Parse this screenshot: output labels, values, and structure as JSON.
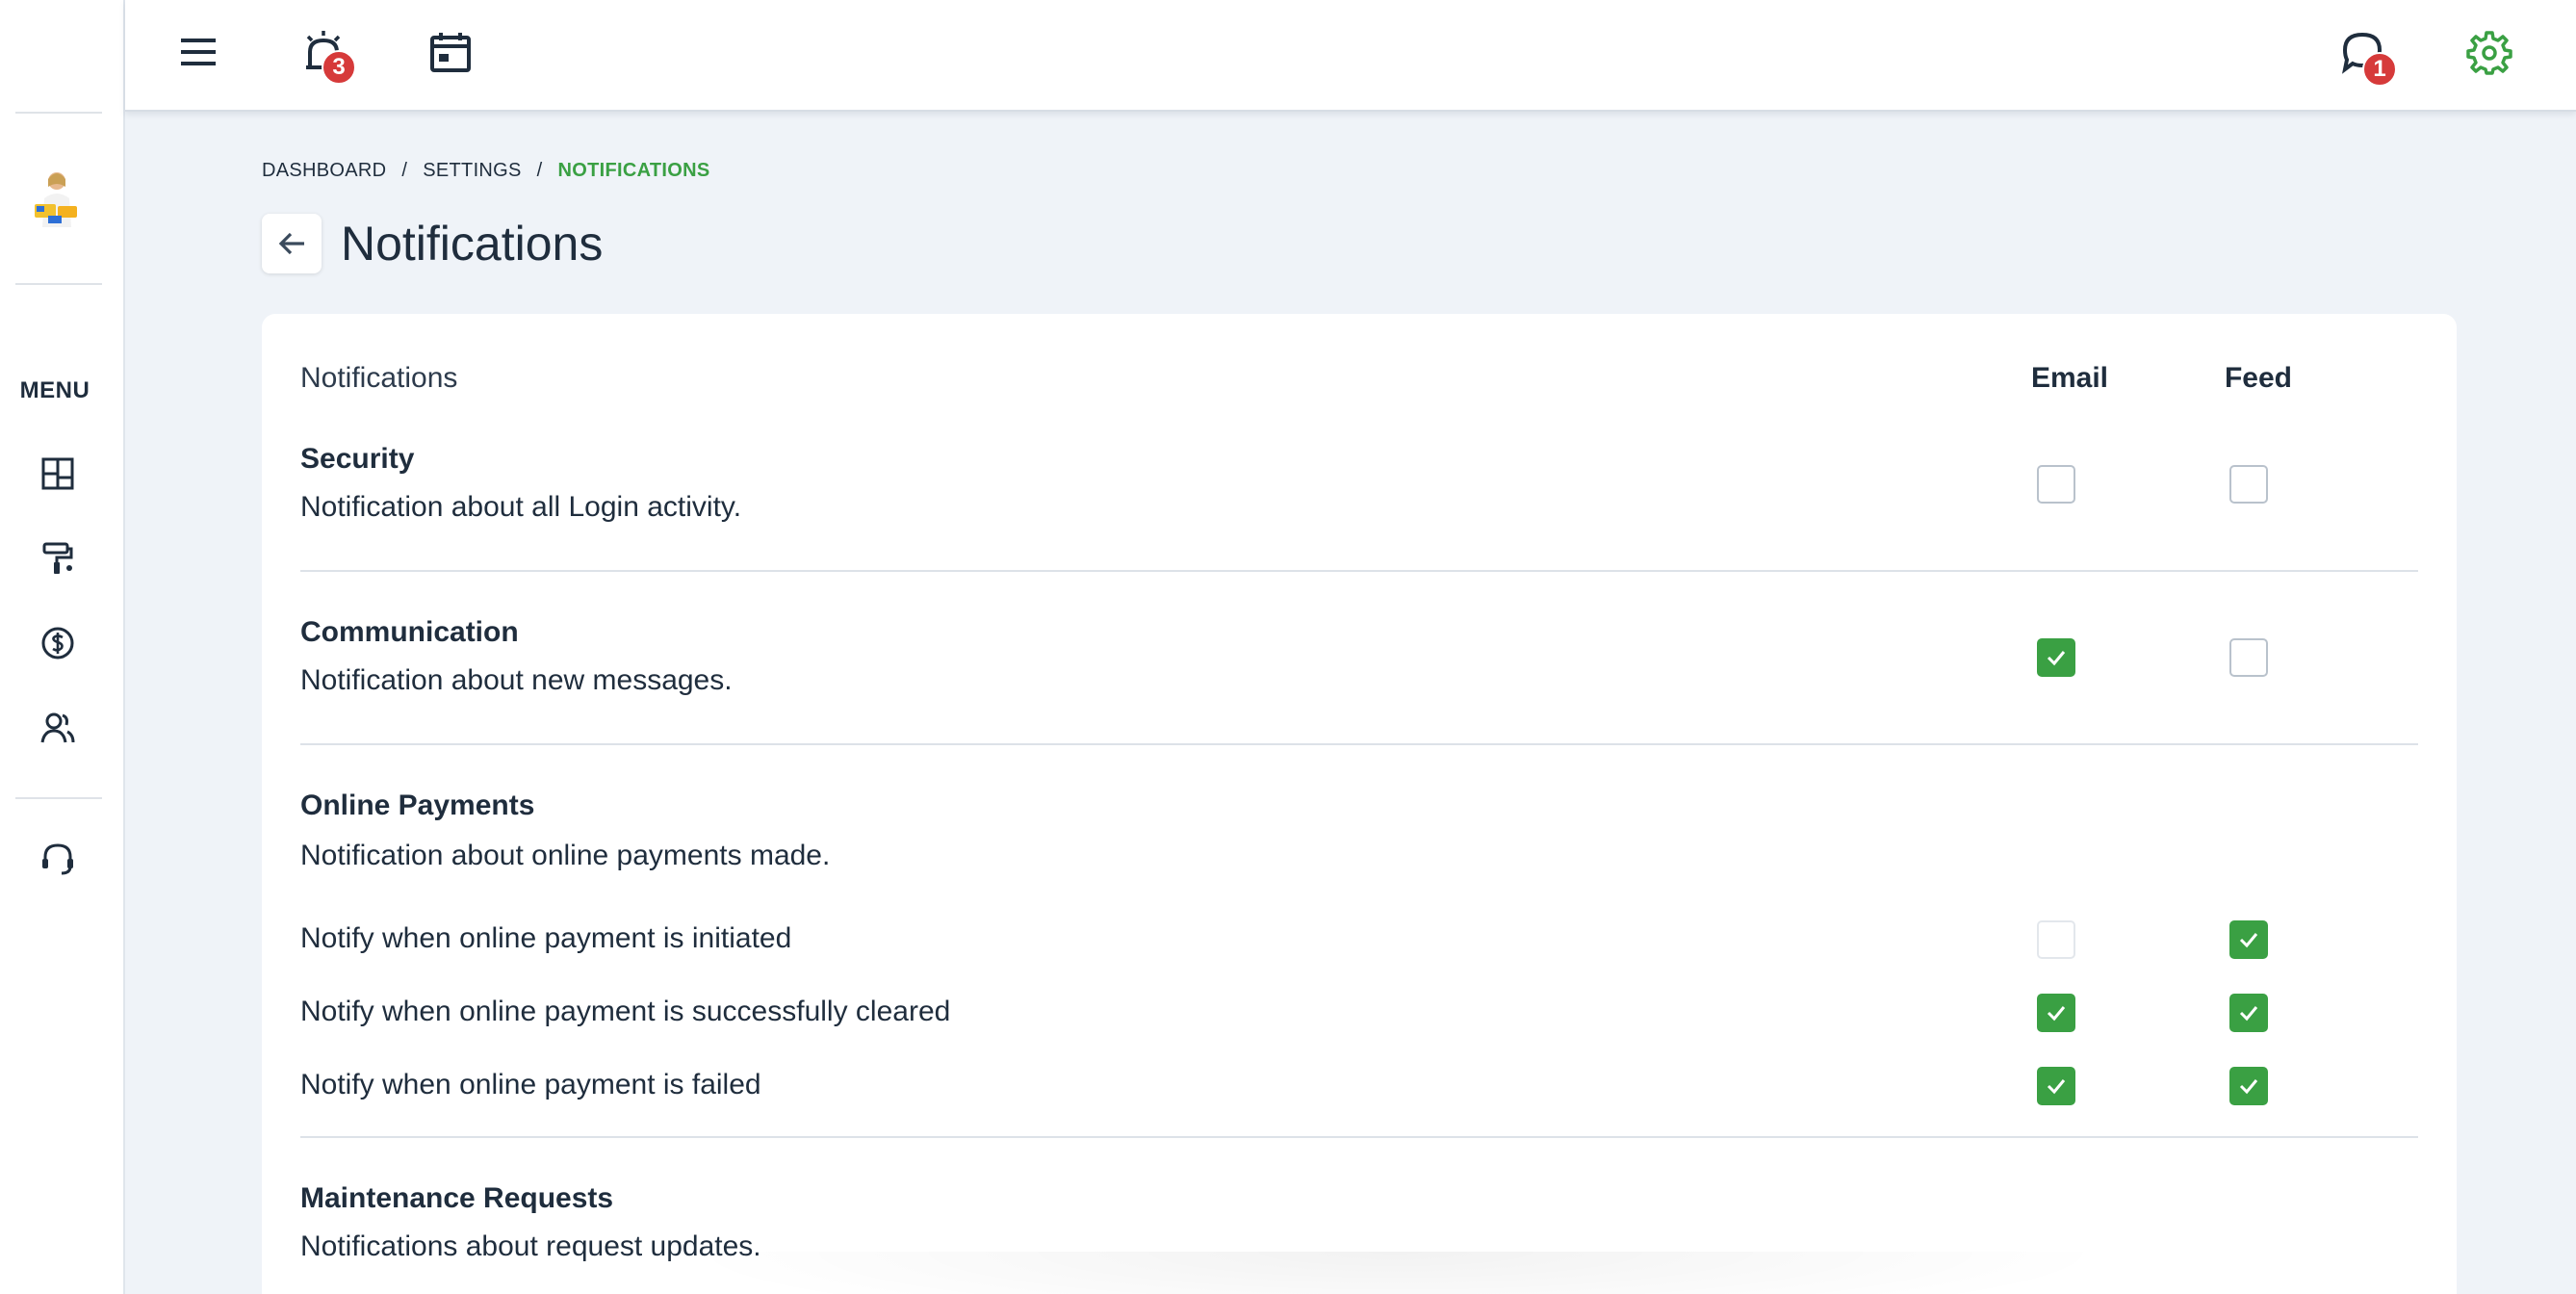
{
  "colors": {
    "accent": "#3aa043",
    "badge": "#d63a3a",
    "text": "#1f2d3d",
    "background": "#eff3f8"
  },
  "sidebar": {
    "menu_label": "MENU",
    "items": [
      {
        "icon": "dashboard-icon"
      },
      {
        "icon": "paint-roller-icon"
      },
      {
        "icon": "dollar-icon"
      },
      {
        "icon": "users-icon"
      },
      {
        "icon": "headset-icon"
      }
    ]
  },
  "topbar": {
    "alerts_count": "3",
    "messages_count": "1"
  },
  "breadcrumb": {
    "items": [
      "DASHBOARD",
      "SETTINGS",
      "NOTIFICATIONS"
    ],
    "separator": "/"
  },
  "page": {
    "title": "Notifications"
  },
  "table": {
    "header": "Notifications",
    "col_email": "Email",
    "col_feed": "Feed",
    "groups": [
      {
        "title": "Security",
        "desc": "Notification about all Login activity.",
        "email": false,
        "feed": false
      },
      {
        "title": "Communication",
        "desc": "Notification about new messages.",
        "email": true,
        "feed": false
      },
      {
        "title": "Online Payments",
        "desc": "Notification about online payments made.",
        "rows": [
          {
            "label": "Notify when online payment is initiated",
            "email": false,
            "feed": true
          },
          {
            "label": "Notify when online payment is successfully cleared",
            "email": true,
            "feed": true
          },
          {
            "label": "Notify when online payment is failed",
            "email": true,
            "feed": true
          }
        ]
      },
      {
        "title": "Maintenance Requests",
        "desc": "Notifications about request updates."
      }
    ]
  }
}
